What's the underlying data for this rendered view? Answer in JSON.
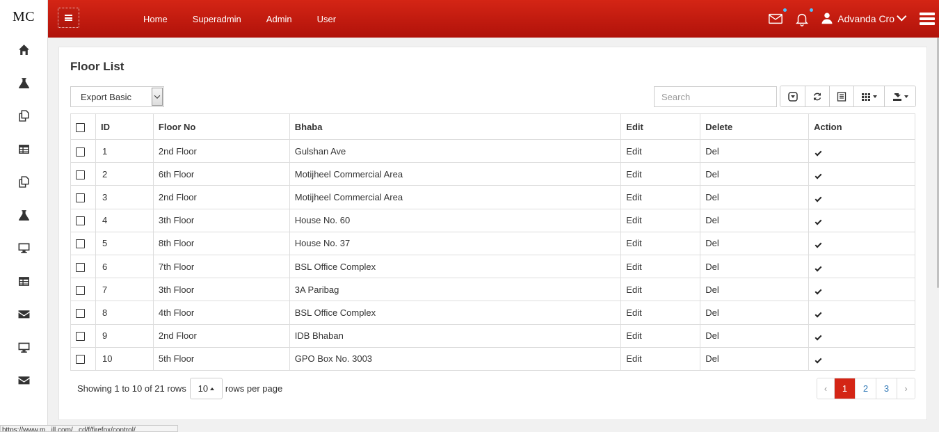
{
  "brand": "MC",
  "sidebar": {
    "icons": [
      "home-icon",
      "flask-icon",
      "copy-icon",
      "table-icon",
      "copy-icon",
      "flask-icon",
      "desktop-icon",
      "table-icon",
      "envelope-icon",
      "desktop-icon",
      "envelope-icon"
    ]
  },
  "topnav": {
    "items": [
      "Home",
      "Superadmin",
      "Admin",
      "User"
    ],
    "user_name": "Advanda Cro"
  },
  "colors": {
    "primary_red": "#d42515",
    "link_blue": "#337ab7",
    "notification_dot": "#4dc3ff"
  },
  "page": {
    "title": "Floor List",
    "export_label": "Export Basic",
    "search_placeholder": "Search"
  },
  "table": {
    "columns": [
      "ID",
      "Floor No",
      "Bhaba",
      "Edit",
      "Delete",
      "Action"
    ],
    "rows": [
      [
        "1",
        "2nd Floor",
        "Gulshan Ave",
        "Edit",
        "Del"
      ],
      [
        "2",
        "6th Floor",
        "Motijheel Commercial Area",
        "Edit",
        "Del"
      ],
      [
        "3",
        "2nd Floor",
        "Motijheel Commercial Area",
        "Edit",
        "Del"
      ],
      [
        "4",
        "3th Floor",
        "House No. 60",
        "Edit",
        "Del"
      ],
      [
        "5",
        "8th Floor",
        "House No. 37",
        "Edit",
        "Del"
      ],
      [
        "6",
        "7th Floor",
        "BSL Office Complex",
        "Edit",
        "Del"
      ],
      [
        "7",
        "3th Floor",
        "3A Paribag",
        "Edit",
        "Del"
      ],
      [
        "8",
        "4th Floor",
        "BSL Office Complex",
        "Edit",
        "Del"
      ],
      [
        "9",
        "2nd Floor",
        "IDB Bhaban",
        "Edit",
        "Del"
      ],
      [
        "10",
        "5th Floor",
        "GPO Box No. 3003",
        "Edit",
        "Del"
      ]
    ]
  },
  "footer": {
    "showing": "Showing 1 to 10 of 21 rows",
    "page_size": "10",
    "rows_per_page": "rows per page",
    "pages": [
      "1",
      "2",
      "3"
    ],
    "prev": "‹",
    "next": "›"
  },
  "statusbar": "https://www.m...ill.com/...cd/f/firefox/control/"
}
